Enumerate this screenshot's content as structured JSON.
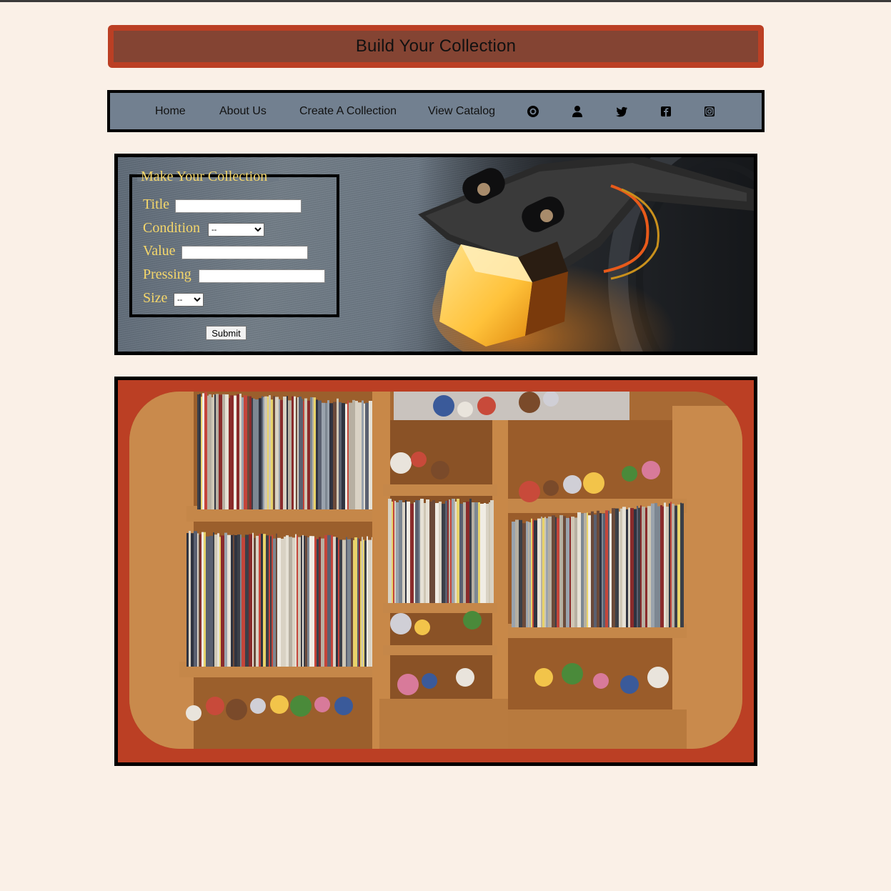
{
  "header": {
    "title": "Build Your Collection"
  },
  "nav": {
    "items": [
      {
        "label": "Home"
      },
      {
        "label": "About Us"
      },
      {
        "label": "Create A Collection"
      },
      {
        "label": "View Catalog"
      }
    ],
    "icons": [
      "vinyl-record-icon",
      "user-icon",
      "twitter-icon",
      "facebook-icon",
      "instagram-icon"
    ]
  },
  "form": {
    "legend": "Make Your Collection",
    "fields": {
      "title": {
        "label": "Title",
        "value": ""
      },
      "condition": {
        "label": "Condition",
        "selected": "--"
      },
      "value": {
        "label": "Value",
        "value": ""
      },
      "pressing": {
        "label": "Pressing",
        "value": ""
      },
      "size": {
        "label": "Size",
        "selected": "--"
      }
    },
    "submit_label": "Submit"
  },
  "colors": {
    "page_background": "#faf0e7",
    "banner_outer": "#bb3f24",
    "banner_inner": "#844433",
    "nav_background": "#728090",
    "form_label": "#f5d76b",
    "shelf_frame": "#bb3f24"
  }
}
